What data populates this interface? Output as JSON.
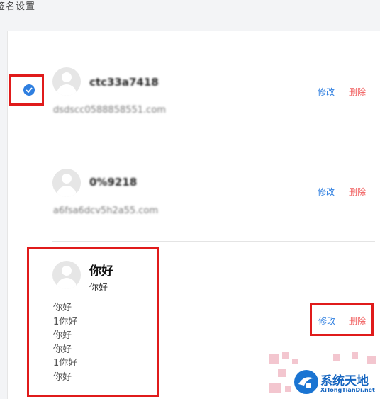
{
  "page": {
    "title": "签名设置"
  },
  "signatures": [
    {
      "name": "ctc33a7418",
      "email": "dsdscc0588858551.com",
      "edit_label": "修改",
      "delete_label": "删除",
      "selected": true
    },
    {
      "name": "0%9218",
      "email": "a6fsa6dcv5h2a55.com",
      "edit_label": "修改",
      "delete_label": "删除",
      "selected": false
    },
    {
      "name": "你好",
      "subtitle": "你好",
      "lines": [
        "你好",
        "1你好",
        "你好",
        "你好",
        "1你好",
        "你好"
      ],
      "edit_label": "修改",
      "delete_label": "删除",
      "selected": false
    }
  ],
  "watermark": {
    "text": "系统天地",
    "url": "XiTongTianDi.net"
  },
  "colors": {
    "accent": "#2f7fe0",
    "delete": "#f05b5b",
    "highlight": "#e01b1b"
  },
  "icons": {
    "check": "check-circle-icon",
    "avatar": "avatar-placeholder-icon"
  }
}
